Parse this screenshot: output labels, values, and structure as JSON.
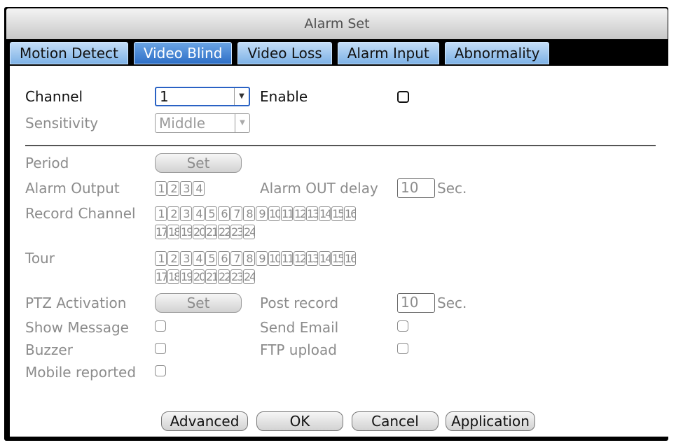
{
  "window": {
    "title": "Alarm Set"
  },
  "tabs": [
    {
      "label": "Motion Detect"
    },
    {
      "label": "Video Blind"
    },
    {
      "label": "Video Loss"
    },
    {
      "label": "Alarm Input"
    },
    {
      "label": "Abnormality"
    }
  ],
  "active_tab": "Video Blind",
  "form": {
    "channel_label": "Channel",
    "channel_value": "1",
    "enable_label": "Enable",
    "sensitivity_label": "Sensitivity",
    "sensitivity_value": "Middle",
    "period_label": "Period",
    "period_button": "Set",
    "alarm_output_label": "Alarm Output",
    "alarm_output_nums": [
      "1",
      "2",
      "3",
      "4"
    ],
    "alarm_out_delay_label": "Alarm OUT delay",
    "alarm_out_delay_value": "10",
    "alarm_out_delay_unit": "Sec.",
    "record_channel_label": "Record Channel",
    "record_channel_row1": [
      "1",
      "2",
      "3",
      "4",
      "5",
      "6",
      "7",
      "8",
      "9",
      "10",
      "11",
      "12",
      "13",
      "14",
      "15",
      "16"
    ],
    "record_channel_row2": [
      "17",
      "18",
      "19",
      "20",
      "21",
      "22",
      "23",
      "24"
    ],
    "tour_label": "Tour",
    "tour_row1": [
      "1",
      "2",
      "3",
      "4",
      "5",
      "6",
      "7",
      "8",
      "9",
      "10",
      "11",
      "12",
      "13",
      "14",
      "15",
      "16"
    ],
    "tour_row2": [
      "17",
      "18",
      "19",
      "20",
      "21",
      "22",
      "23",
      "24"
    ],
    "ptz_label": "PTZ Activation",
    "ptz_button": "Set",
    "post_record_label": "Post record",
    "post_record_value": "10",
    "post_record_unit": "Sec.",
    "show_message_label": "Show Message",
    "send_email_label": "Send Email",
    "buzzer_label": "Buzzer",
    "ftp_upload_label": "FTP upload",
    "mobile_reported_label": "Mobile reported"
  },
  "footer": {
    "advanced": "Advanced",
    "ok": "OK",
    "cancel": "Cancel",
    "application": "Application"
  }
}
